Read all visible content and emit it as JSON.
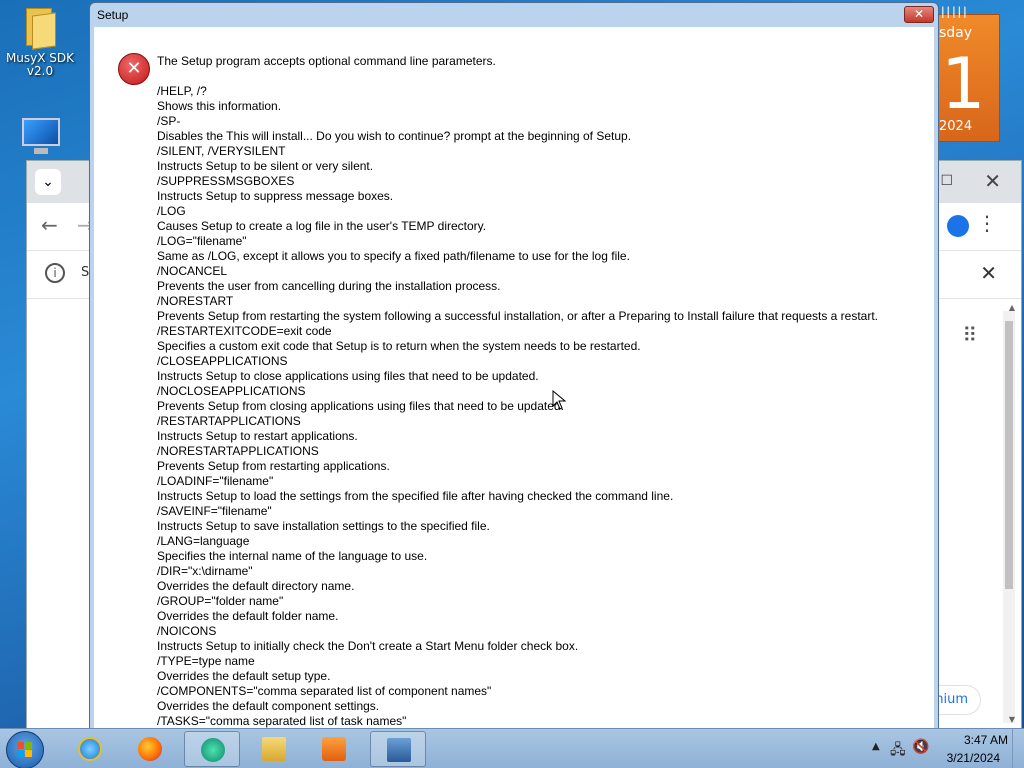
{
  "desktop": {
    "icons": [
      {
        "label": "MusyX SDK v2.0"
      }
    ]
  },
  "calendar": {
    "day_fragment": "sday",
    "day_number": "1",
    "year_fragment": "2024"
  },
  "browser": {
    "info_text_fragment": "S",
    "premium_fragment": "mium"
  },
  "dialog": {
    "title": "Setup",
    "close_label": "✕",
    "intro": "The Setup program accepts optional command line parameters.",
    "lines": [
      "/HELP, /?",
      "Shows this information.",
      "/SP-",
      "Disables the This will install... Do you wish to continue? prompt at the beginning of Setup.",
      "/SILENT, /VERYSILENT",
      "Instructs Setup to be silent or very silent.",
      "/SUPPRESSMSGBOXES",
      "Instructs Setup to suppress message boxes.",
      "/LOG",
      "Causes Setup to create a log file in the user's TEMP directory.",
      "/LOG=\"filename\"",
      "Same as /LOG, except it allows you to specify a fixed path/filename to use for the log file.",
      "/NOCANCEL",
      "Prevents the user from cancelling during the installation process.",
      "/NORESTART",
      "Prevents Setup from restarting the system following a successful installation, or after a Preparing to Install failure that requests a restart.",
      "/RESTARTEXITCODE=exit code",
      "Specifies a custom exit code that Setup is to return when the system needs to be restarted.",
      "/CLOSEAPPLICATIONS",
      "Instructs Setup to close applications using files that need to be updated.",
      "/NOCLOSEAPPLICATIONS",
      "Prevents Setup from closing applications using files that need to be updated.",
      "/RESTARTAPPLICATIONS",
      "Instructs Setup to restart applications.",
      "/NORESTARTAPPLICATIONS",
      "Prevents Setup from restarting applications.",
      "/LOADINF=\"filename\"",
      "Instructs Setup to load the settings from the specified file after having checked the command line.",
      "/SAVEINF=\"filename\"",
      "Instructs Setup to save installation settings to the specified file.",
      "/LANG=language",
      "Specifies the internal name of the language to use.",
      "/DIR=\"x:\\dirname\"",
      "Overrides the default directory name.",
      "/GROUP=\"folder name\"",
      "Overrides the default folder name.",
      "/NOICONS",
      "Instructs Setup to initially check the Don't create a Start Menu folder check box.",
      "/TYPE=type name",
      "Overrides the default setup type.",
      "/COMPONENTS=\"comma separated list of component names\"",
      "Overrides the default component settings.",
      "/TASKS=\"comma separated list of task names\""
    ]
  },
  "taskbar": {
    "time": "3:47 AM",
    "date": "3/21/2024"
  },
  "colors": {
    "dialog_frame": "#bcd3ee",
    "error_red": "#c21616",
    "taskbar": "#a9c6e3",
    "calendar_orange": "#e8781f"
  }
}
